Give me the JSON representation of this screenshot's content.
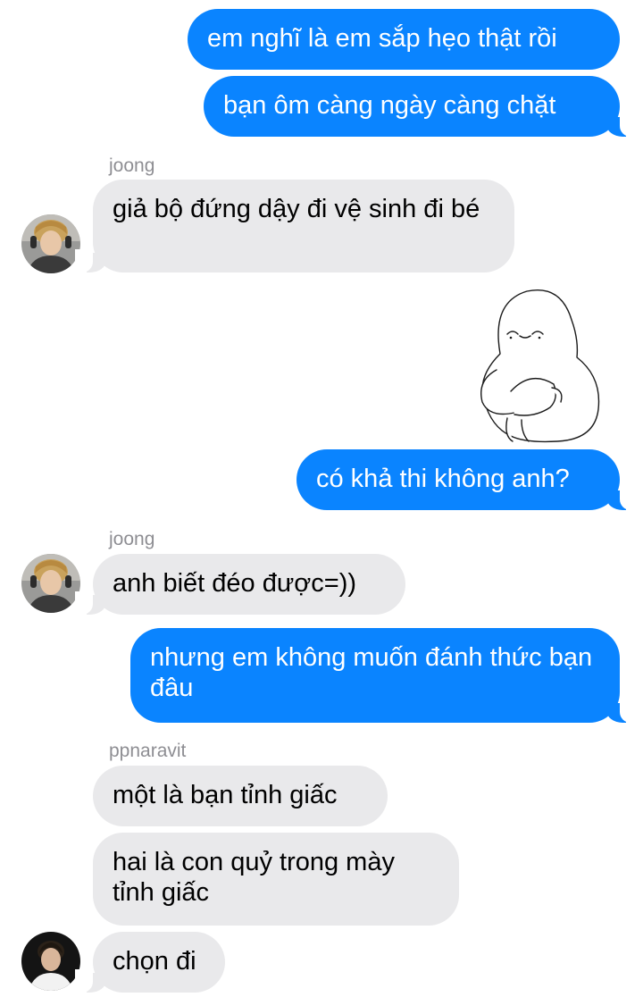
{
  "messages": [
    {
      "id": "m1",
      "side": "out",
      "text": "em nghĩ là em sắp hẹo thật rồi"
    },
    {
      "id": "m2",
      "side": "out",
      "text": "bạn ôm càng ngày càng chặt"
    },
    {
      "id": "m3",
      "side": "in",
      "sender": "joong",
      "text": "giả bộ đứng dậy đi vệ sinh đi bé"
    },
    {
      "id": "m4",
      "side": "out",
      "text": "có khả thi không anh?"
    },
    {
      "id": "m5",
      "side": "in",
      "sender": "joong",
      "text": "anh biết đéo được=))"
    },
    {
      "id": "m6",
      "side": "out",
      "text": "nhưng em không muốn đánh thức bạn đâu"
    },
    {
      "id": "m7",
      "side": "in",
      "sender": "ppnaravit",
      "text": "một là bạn tỉnh giấc"
    },
    {
      "id": "m8",
      "side": "in",
      "text": "hai là con quỷ trong mày tỉnh giấc"
    },
    {
      "id": "m9",
      "side": "in",
      "text": "chọn đi"
    }
  ],
  "senders": {
    "joong_1": "joong",
    "joong_2": "joong",
    "ppnaravit": "ppnaravit"
  },
  "icons": {
    "sticker": "hugging-knees-blob-sticker",
    "avatar_joong": "avatar-joong",
    "avatar_ppnaravit": "avatar-ppnaravit"
  },
  "colors": {
    "outgoing_bubble": "#0a84ff",
    "incoming_bubble": "#e9e9eb",
    "sender_name": "#8e8e93"
  }
}
